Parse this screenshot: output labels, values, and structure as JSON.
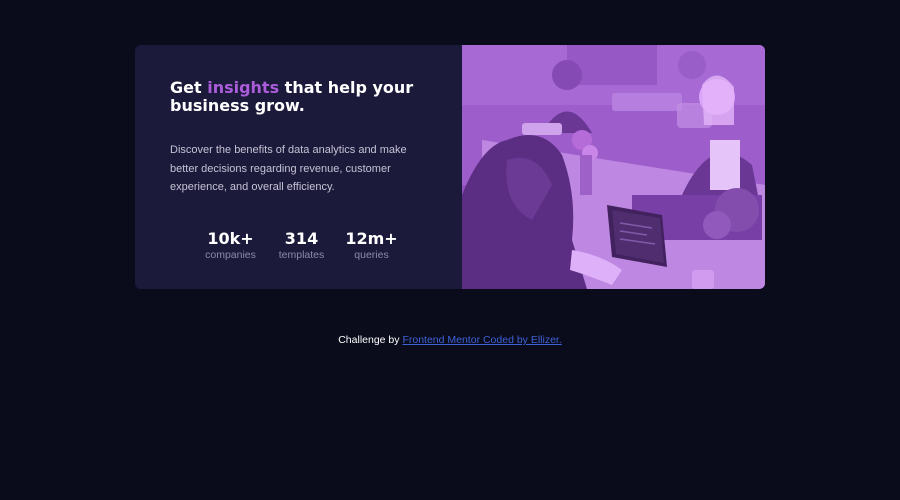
{
  "card": {
    "headline_before": "Get ",
    "headline_accent": "insights",
    "headline_after": " that help your business grow.",
    "description": "Discover the benefits of data analytics and make better decisions regarding revenue, customer experience, and overall efficiency.",
    "stats": [
      {
        "value": "10k+",
        "label": "companies"
      },
      {
        "value": "314",
        "label": "templates"
      },
      {
        "value": "12m+",
        "label": "queries"
      }
    ]
  },
  "attribution": {
    "prefix": "Challenge by ",
    "link_text": "Frontend Mentor Coded by Ellizer."
  },
  "colors": {
    "page_background": "#0a0c1c",
    "card_background": "#1c1a3b",
    "accent": "#ab5cdb",
    "photo_tint": "#9a5ec8",
    "link": "#3e62d6"
  },
  "image": {
    "subject": "people-working-in-office-photo"
  }
}
